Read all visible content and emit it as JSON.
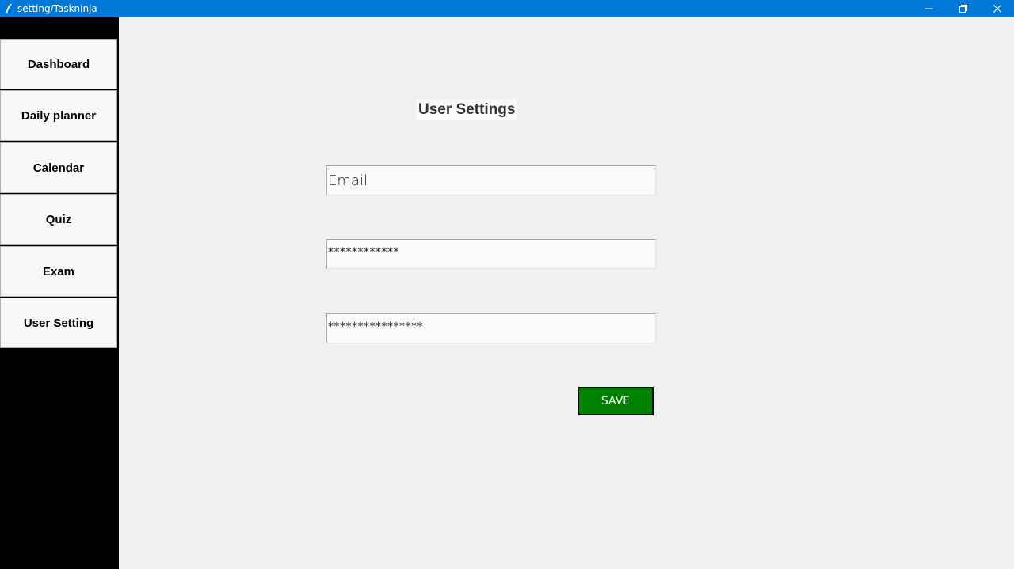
{
  "window": {
    "title": "setting/Taskninja",
    "icons": [
      "feather-icon",
      "minimize-icon",
      "restore-icon",
      "close-icon"
    ]
  },
  "sidebar": {
    "items": [
      {
        "label": "Dashboard"
      },
      {
        "label": "Daily planner"
      },
      {
        "label": "Calendar"
      },
      {
        "label": "Quiz"
      },
      {
        "label": "Exam"
      },
      {
        "label": "User Setting"
      }
    ]
  },
  "main": {
    "title": "User Settings",
    "email_value": "Email",
    "password_value": "************",
    "confirm_password_value": "****************",
    "save_label": "SAVE"
  },
  "colors": {
    "titlebar": "#0078d7",
    "sidebar": "#000000",
    "save_button": "#008000",
    "background": "#f0f0f0"
  }
}
